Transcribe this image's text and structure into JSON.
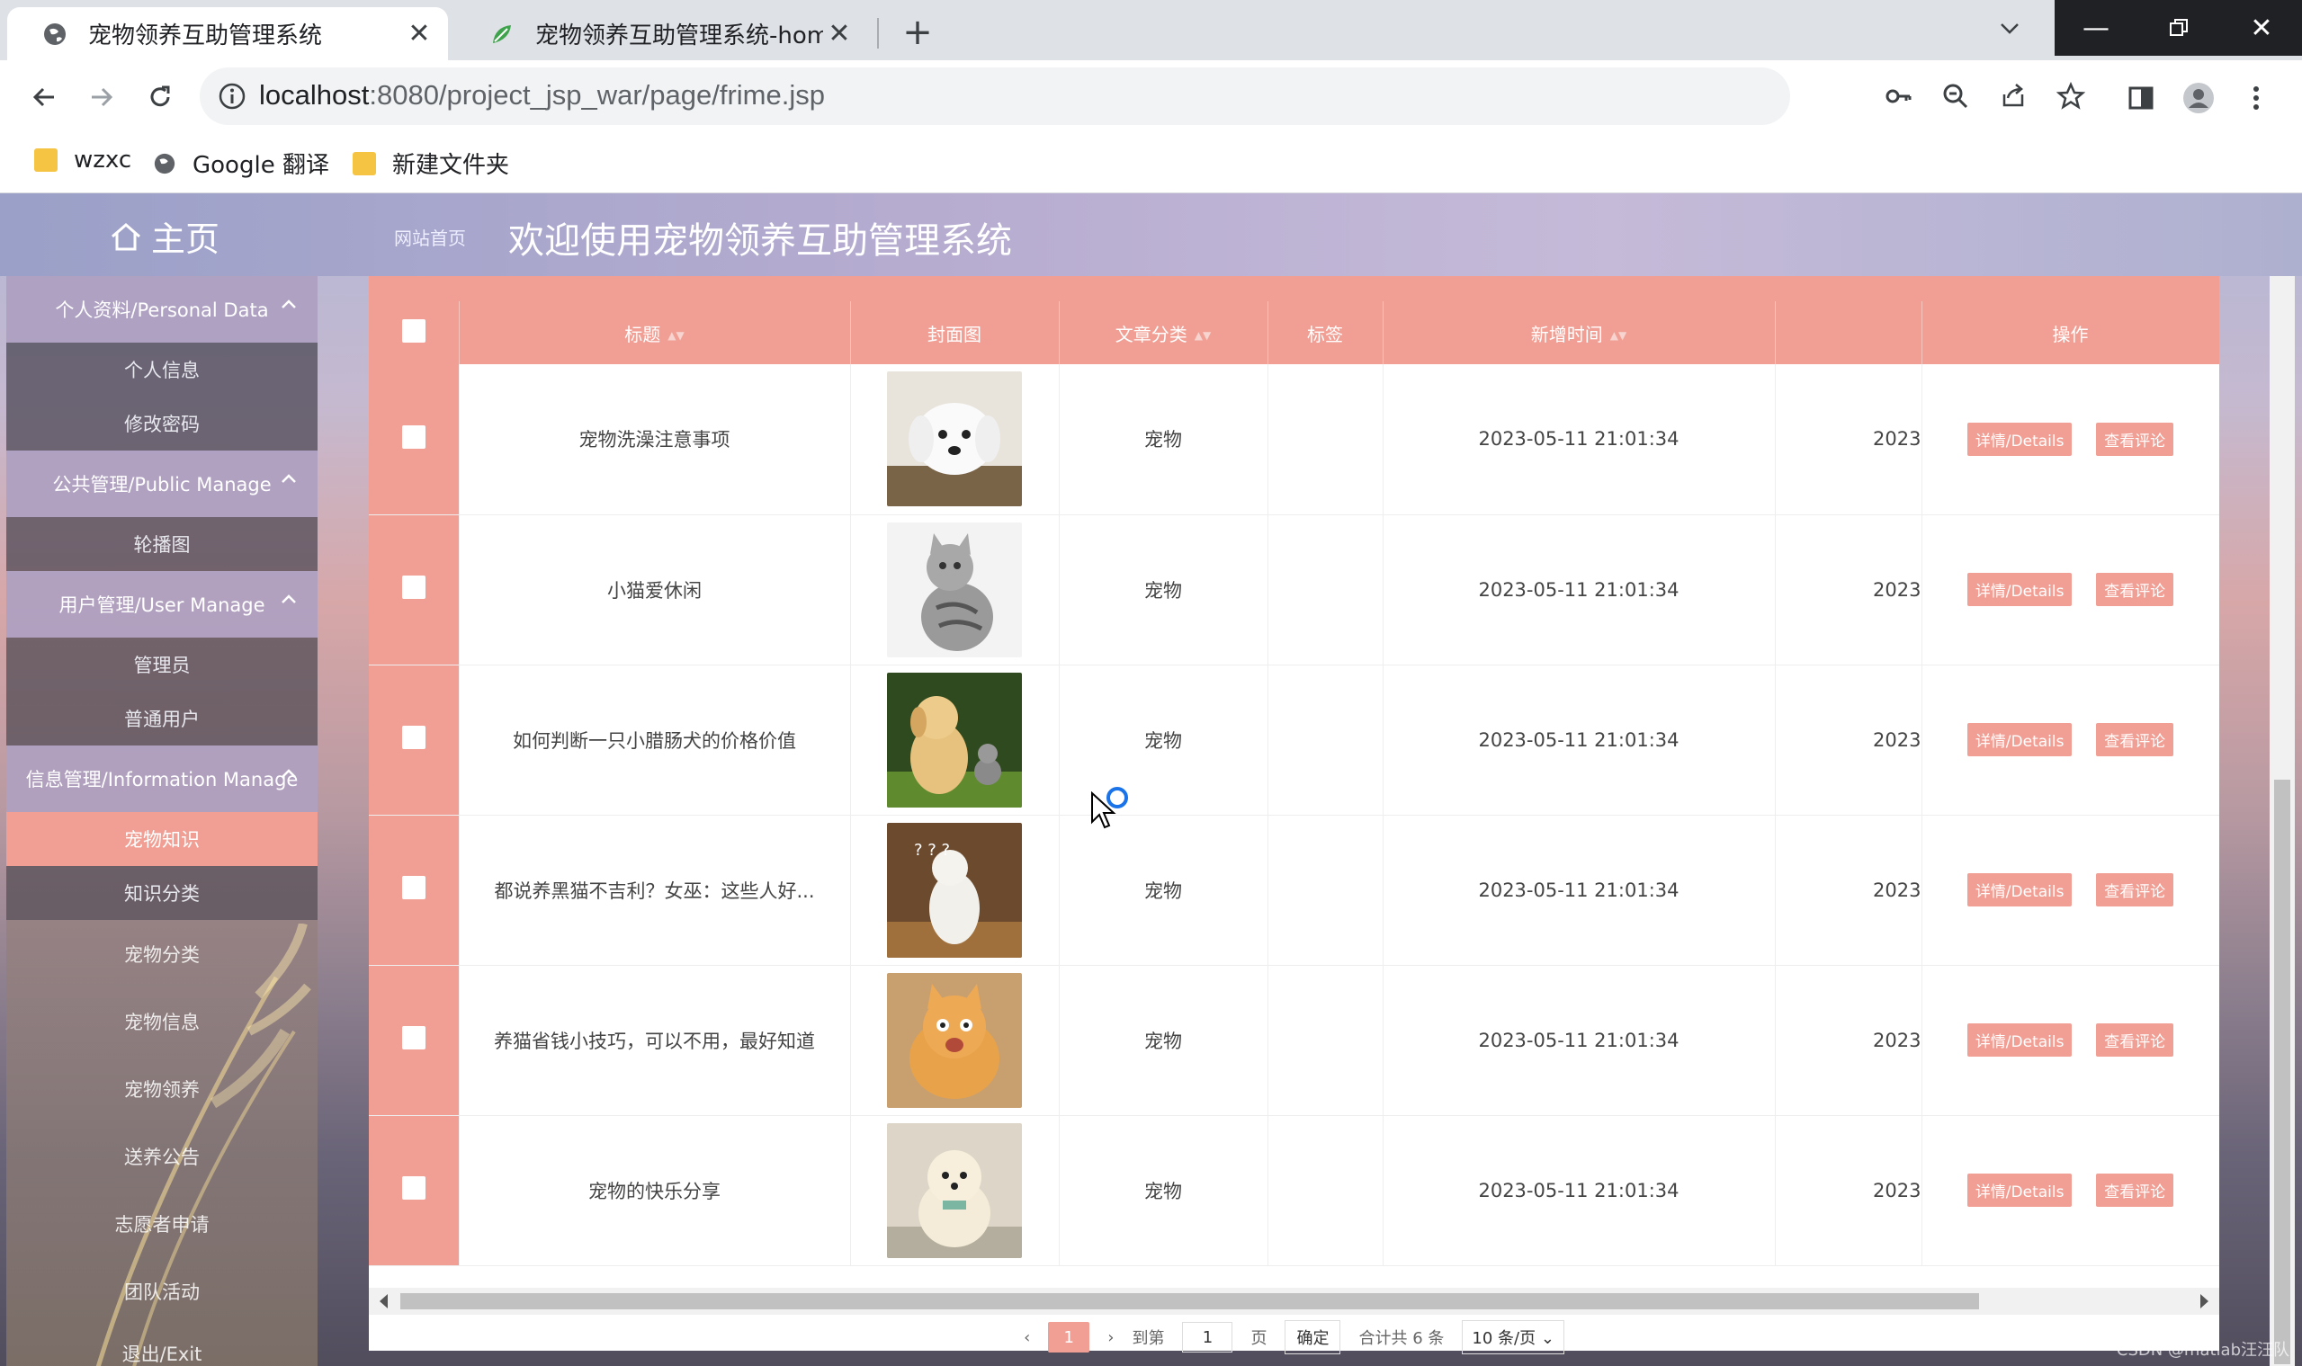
{
  "browser": {
    "tabs": [
      {
        "title": "宠物领养互助管理系统",
        "active": true
      },
      {
        "title": "宠物领养互助管理系统-home",
        "active": false
      }
    ],
    "new_tab": "+",
    "url_host": "localhost",
    "url_rest": ":8080/project_jsp_war/page/frime.jsp",
    "bookmarks": [
      "wzxc",
      "Google 翻译",
      "新建文件夹"
    ]
  },
  "header": {
    "home_label": "主页",
    "crumb": "网站首页",
    "title": "欢迎使用宠物领养互助管理系统"
  },
  "sidebar": {
    "groups": [
      {
        "label": "个人资料/Personal Data",
        "items": [
          "个人信息",
          "修改密码"
        ]
      },
      {
        "label": "公共管理/Public Manage",
        "items": [
          "轮播图"
        ]
      },
      {
        "label": "用户管理/User Manage",
        "items": [
          "管理员",
          "普通用户"
        ]
      },
      {
        "label": "信息管理/Information Manage",
        "items": [
          "宠物知识",
          "知识分类"
        ]
      }
    ],
    "more_items": [
      "宠物分类",
      "宠物信息",
      "宠物领养",
      "送养公告",
      "志愿者申请",
      "团队活动",
      "退出/Exit"
    ],
    "active_item": "宠物知识"
  },
  "table": {
    "columns": [
      "标题",
      "封面图",
      "文章分类",
      "标签",
      "新增时间",
      "",
      "操作"
    ],
    "rows": [
      {
        "title": "宠物洗澡注意事项",
        "category": "宠物",
        "tag": "",
        "time": "2023-05-11 21:01:34",
        "cut": "2023",
        "image": "white-puppy"
      },
      {
        "title": "小猫爱休闲",
        "category": "宠物",
        "tag": "",
        "time": "2023-05-11 21:01:34",
        "cut": "2023",
        "image": "tabby-cat"
      },
      {
        "title": "如何判断一只小腊肠犬的价格价值",
        "category": "宠物",
        "tag": "",
        "time": "2023-05-11 21:01:34",
        "cut": "2023",
        "image": "puppy-kitten"
      },
      {
        "title": "都说养黑猫不吉利？女巫：这些人好...",
        "category": "宠物",
        "tag": "",
        "time": "2023-05-11 21:01:34",
        "cut": "2023",
        "image": "confused-cat"
      },
      {
        "title": "养猫省钱小技巧，可以不用，最好知道",
        "category": "宠物",
        "tag": "",
        "time": "2023-05-11 21:01:34",
        "cut": "2023",
        "image": "orange-cat"
      },
      {
        "title": "宠物的快乐分享",
        "category": "宠物",
        "tag": "",
        "time": "2023-05-11 21:01:34",
        "cut": "2023",
        "image": "pomeranian"
      }
    ],
    "btn_details": "详情/Details",
    "btn_comments": "查看评论"
  },
  "pager": {
    "current": "1",
    "goto_label": "到第",
    "goto_value": "1",
    "page_label": "页",
    "confirm": "确定",
    "total": "合计共 6 条",
    "per_page": "10 条/页"
  },
  "watermark": "CSDN @matlab汪汪队",
  "colors": {
    "accent": "#f19f94",
    "chrome": "#dee1e6"
  }
}
